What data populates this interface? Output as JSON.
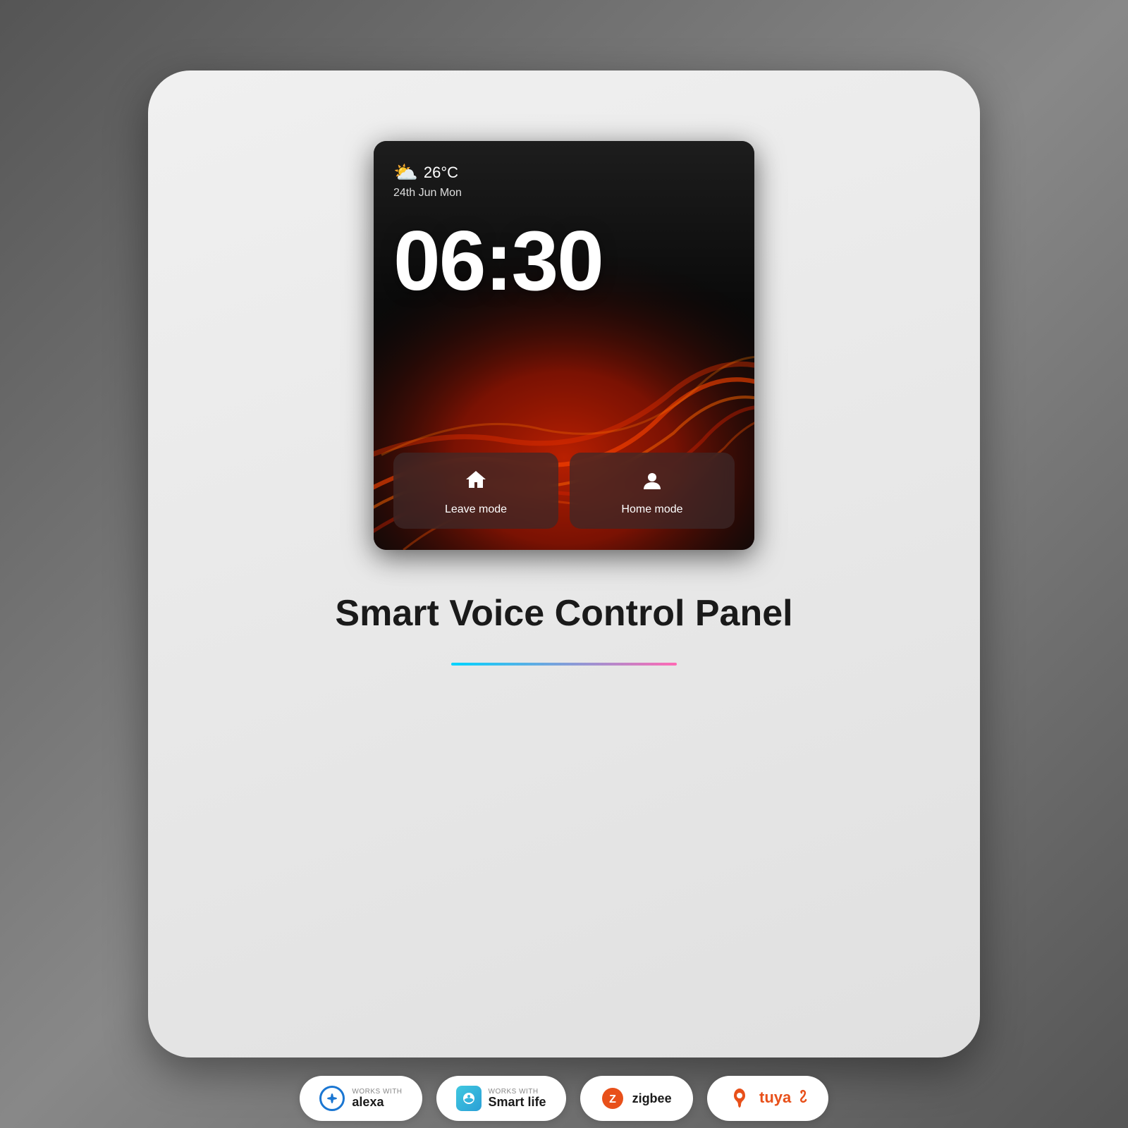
{
  "background": {
    "color": "#6a6a6a"
  },
  "card": {
    "border_radius": "60px"
  },
  "device": {
    "weather": {
      "temp": "26°C",
      "date": "24th Jun Mon",
      "icon": "⛅"
    },
    "clock": {
      "time": "06:30"
    },
    "modes": [
      {
        "label": "Leave mode",
        "icon": "house"
      },
      {
        "label": "Home mode",
        "icon": "person"
      }
    ]
  },
  "product": {
    "title": "Smart Voice Control Panel"
  },
  "badges": [
    {
      "works_with": "WORKS WITH",
      "brand": "alexa",
      "display": "alexa"
    },
    {
      "works_with": "WORKS WITH",
      "brand": "smartlife",
      "display": "Smart life"
    },
    {
      "works_with": "",
      "brand": "zigbee",
      "display": "zigbee"
    },
    {
      "works_with": "",
      "brand": "tuya",
      "display": "tuya"
    }
  ]
}
